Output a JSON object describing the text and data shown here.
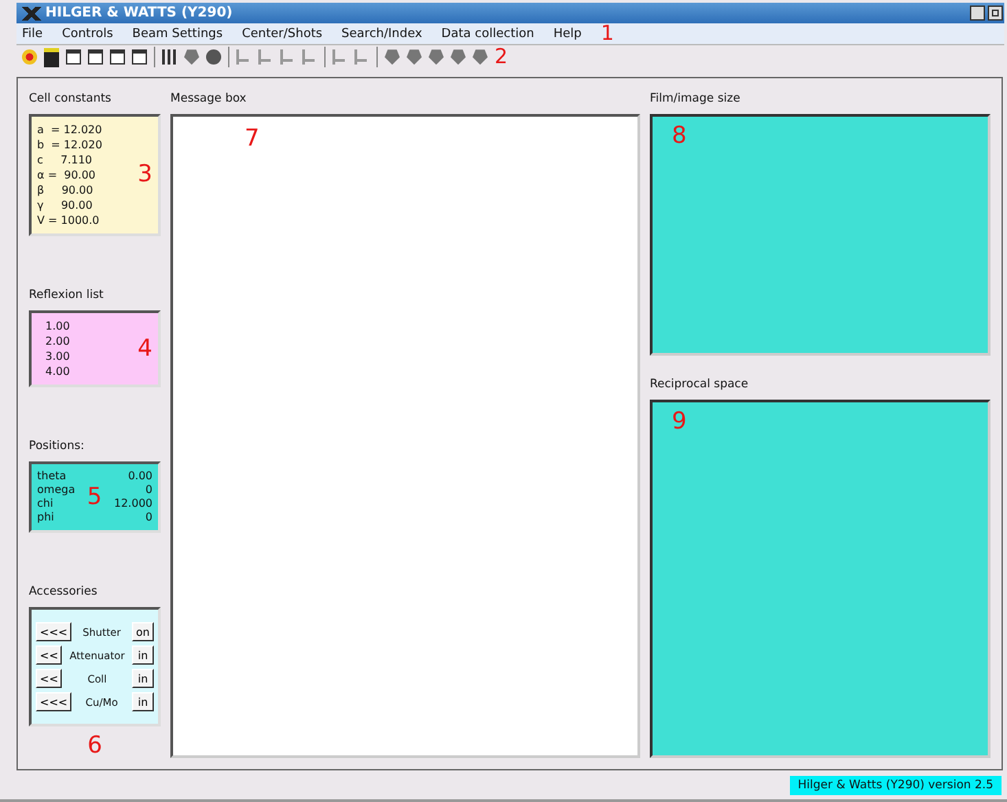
{
  "window": {
    "title": "HILGER & WATTS (Y290)"
  },
  "menu": [
    "File",
    "Controls",
    "Beam Settings",
    "Center/Shots",
    "Search/Index",
    "Data collection",
    "Help"
  ],
  "menu_callout": "1",
  "toolbar": {
    "callout": "2"
  },
  "cell_constants": {
    "label": "Cell constants",
    "lines": [
      "a  = 12.020",
      "b  = 12.020",
      "c     7.110",
      "α =  90.00",
      "β     90.00",
      "γ     90.00",
      "V = 1000.0"
    ],
    "callout": "3"
  },
  "orientation": {
    "label": "Reflexion list",
    "lines": [
      "1.00",
      "2.00",
      "3.00",
      "4.00"
    ],
    "callout": "4"
  },
  "positions": {
    "label": "Positions:",
    "rows": [
      {
        "name": "theta",
        "value": "0.00"
      },
      {
        "name": "omega",
        "value": "0"
      },
      {
        "name": "chi",
        "value": "12.000"
      },
      {
        "name": "phi",
        "value": "0"
      }
    ],
    "callout": "5"
  },
  "accessories": {
    "label": "Accessories",
    "rows": [
      {
        "left": "<<<",
        "name": "Shutter",
        "right": "on"
      },
      {
        "left": "<<",
        "name": "Attenuator",
        "right": "in"
      },
      {
        "left": "<<",
        "name": "Coll",
        "right": "in"
      },
      {
        "left": "<<<",
        "name": "Cu/Mo",
        "right": "in"
      }
    ],
    "callout": "6"
  },
  "message_box": {
    "label": "Message box",
    "callout": "7"
  },
  "film_image": {
    "label": "Film/image size",
    "callout": "8"
  },
  "reciprocal_space": {
    "label": "Reciprocal space",
    "callout": "9"
  },
  "status_bar": "Hilger & Watts (Y290) version 2.5"
}
